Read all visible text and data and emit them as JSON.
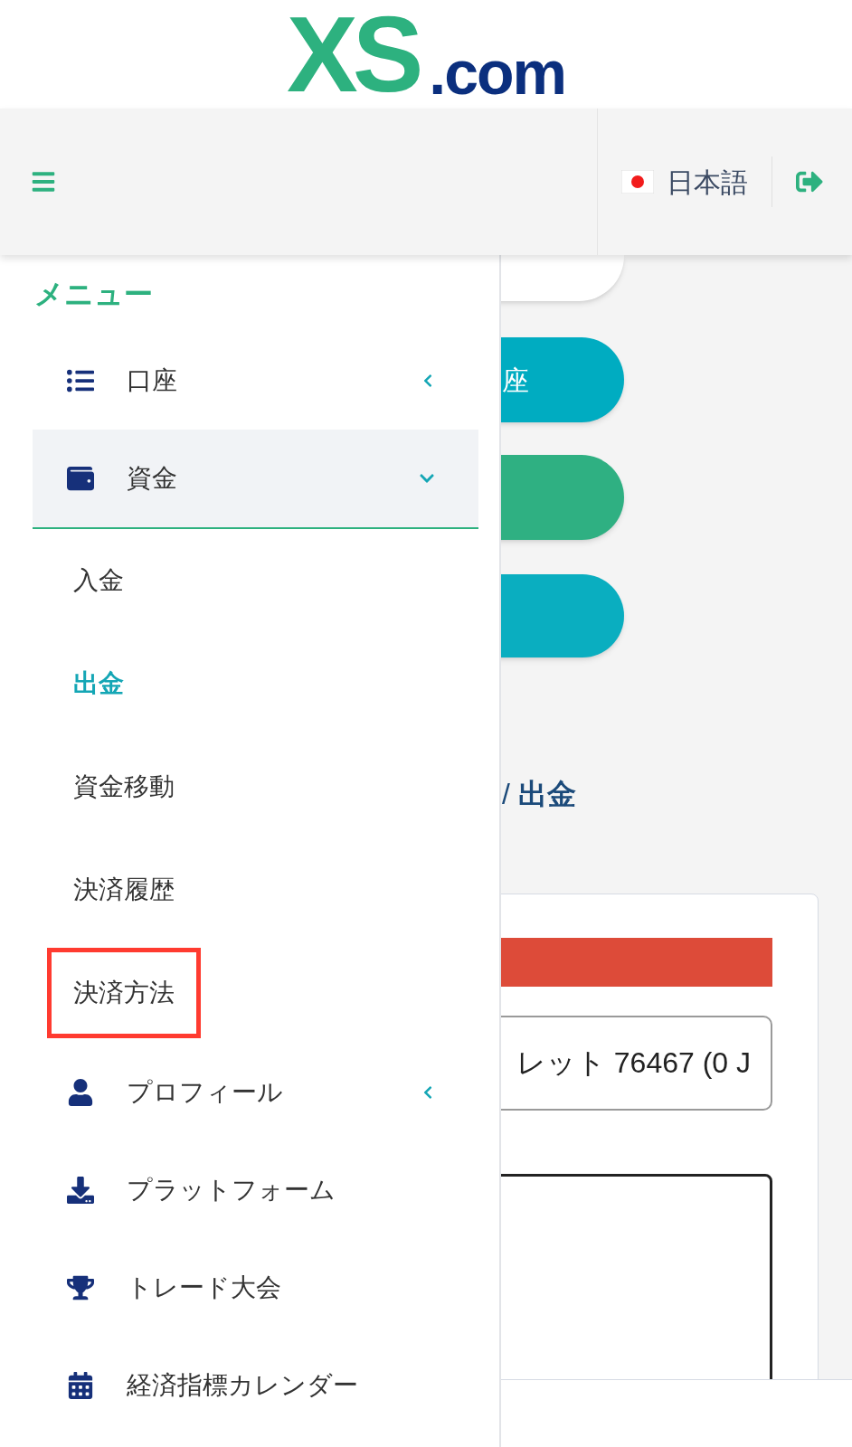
{
  "logo": {
    "mark": "XS",
    "suffix": ".com"
  },
  "header": {
    "language": "日本語"
  },
  "page": {
    "pills": [
      {
        "color": "#ffffff"
      },
      {
        "color": "#00acc1",
        "label": "座"
      },
      {
        "color": "#2fb082"
      },
      {
        "color": "#0aaec0"
      }
    ],
    "breadcrumb": "/ **出金**",
    "card": {
      "select_value": "レット 76467 (0 J"
    }
  },
  "menu": {
    "title": "メニュー",
    "items": [
      {
        "label": "口座",
        "expanded": false
      },
      {
        "label": "資金",
        "expanded": true,
        "children": [
          {
            "label": "入金",
            "selected": false,
            "highlighted": false
          },
          {
            "label": "出金",
            "selected": true,
            "highlighted": false
          },
          {
            "label": "資金移動",
            "selected": false,
            "highlighted": false
          },
          {
            "label": "決済履歴",
            "selected": false,
            "highlighted": false
          },
          {
            "label": "決済方法",
            "selected": false,
            "highlighted": true
          }
        ]
      },
      {
        "label": "プロフィール",
        "expanded": false
      },
      {
        "label": "プラットフォーム"
      },
      {
        "label": "トレード大会"
      },
      {
        "label": "経済指標カレンダー"
      }
    ]
  }
}
